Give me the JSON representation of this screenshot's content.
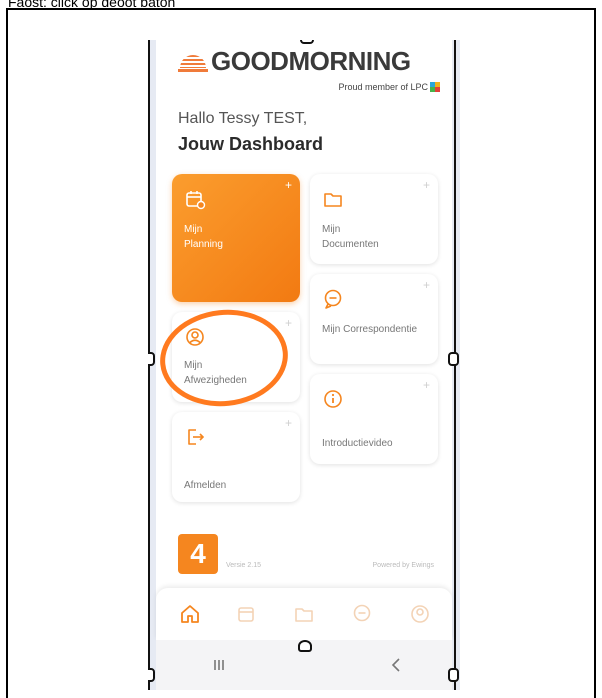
{
  "caption": "Faost: click op deoot baton",
  "header": {
    "brand": "GOODMORNING",
    "member": "Proud member of LPC",
    "greeting": "Hallo Tessy TEST,",
    "title": "Jouw Dashboard"
  },
  "tiles": {
    "planning": "Mijn Planning",
    "documenten": "Mijn Documenten",
    "correspondentie": "Mijn Correspondentie",
    "afwezigheden": "Mijn Afwezigheden",
    "introductievideo": "Introductievideo",
    "afmelden": "Afmelden",
    "plus": "+"
  },
  "footer": {
    "version_number": "4",
    "version_text": "Versie 2.15",
    "powered": "Powered by Ewings"
  },
  "colors": {
    "accent": "#f5861f",
    "annotation": "#ff7a1f"
  },
  "icons": [
    "sun-logo-icon",
    "calendar-icon",
    "folder-icon",
    "chat-icon",
    "user-icon",
    "info-icon",
    "logout-icon",
    "home-icon",
    "menu-icon",
    "back-icon"
  ]
}
